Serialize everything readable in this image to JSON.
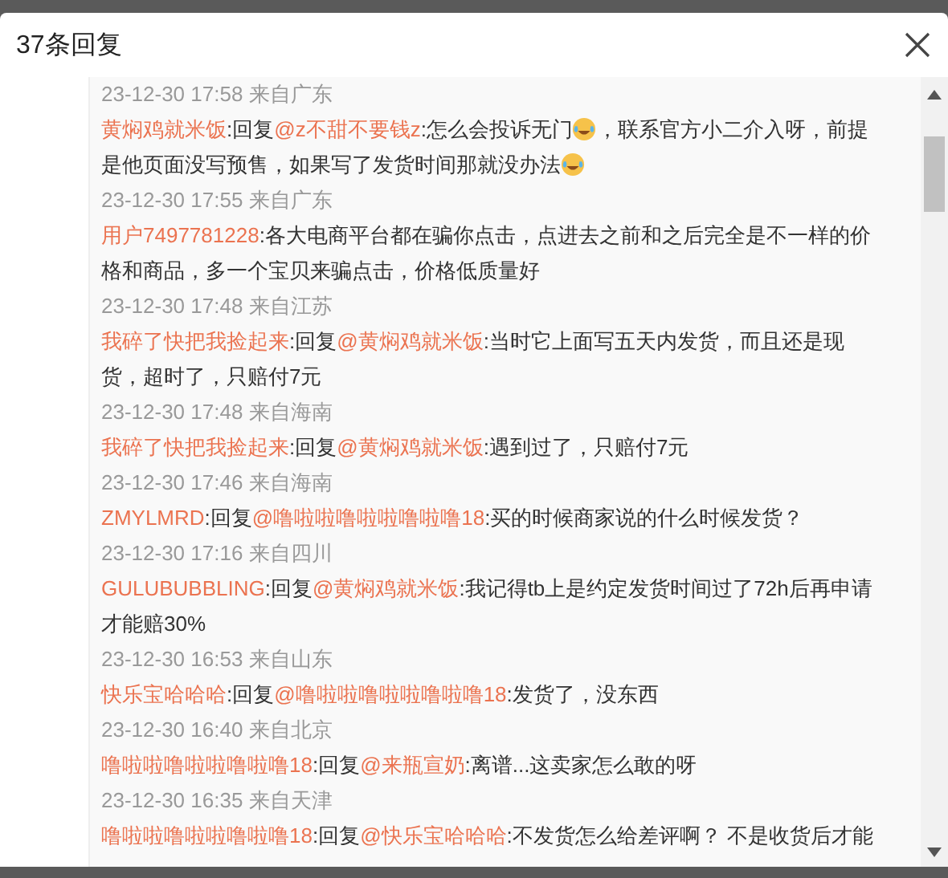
{
  "dialog": {
    "title": "37条回复"
  },
  "comments": [
    {
      "time": "23-12-30 17:58 来自广东",
      "body": [
        {
          "kind": "user",
          "text": "黄焖鸡就米饭"
        },
        {
          "kind": "text",
          "text": ":回复"
        },
        {
          "kind": "user",
          "text": "@z不甜不要钱z"
        },
        {
          "kind": "text",
          "text": ":怎么会投诉无门"
        },
        {
          "kind": "emoji"
        },
        {
          "kind": "text",
          "text": "，联系官方小二介入呀，前提是他页面没写预售，如果写了发货时间那就没办法"
        },
        {
          "kind": "emoji"
        }
      ]
    },
    {
      "time": "23-12-30 17:55 来自广东",
      "body": [
        {
          "kind": "user",
          "text": "用户7497781228"
        },
        {
          "kind": "text",
          "text": ":各大电商平台都在骗你点击，点进去之前和之后完全是不一样的价格和商品，多一个宝贝来骗点击，价格低质量好"
        }
      ]
    },
    {
      "time": "23-12-30 17:48 来自江苏",
      "body": [
        {
          "kind": "user",
          "text": "我碎了快把我捡起来"
        },
        {
          "kind": "text",
          "text": ":回复"
        },
        {
          "kind": "user",
          "text": "@黄焖鸡就米饭"
        },
        {
          "kind": "text",
          "text": ":当时它上面写五天内发货，而且还是现货，超时了，只赔付7元"
        }
      ]
    },
    {
      "time": "23-12-30 17:48 来自海南",
      "body": [
        {
          "kind": "user",
          "text": "我碎了快把我捡起来"
        },
        {
          "kind": "text",
          "text": ":回复"
        },
        {
          "kind": "user",
          "text": "@黄焖鸡就米饭"
        },
        {
          "kind": "text",
          "text": ":遇到过了，只赔付7元"
        }
      ]
    },
    {
      "time": "23-12-30 17:46 来自海南",
      "body": [
        {
          "kind": "user",
          "text": "ZMYLMRD"
        },
        {
          "kind": "text",
          "text": ":回复"
        },
        {
          "kind": "user",
          "text": "@噜啦啦噜啦啦噜啦噜18"
        },
        {
          "kind": "text",
          "text": ":买的时候商家说的什么时候发货？"
        }
      ]
    },
    {
      "time": "23-12-30 17:16 来自四川",
      "body": [
        {
          "kind": "user",
          "text": "GULUBUBBLING"
        },
        {
          "kind": "text",
          "text": ":回复"
        },
        {
          "kind": "user",
          "text": "@黄焖鸡就米饭"
        },
        {
          "kind": "text",
          "text": ":我记得tb上是约定发货时间过了72h后再申请才能赔30%"
        }
      ]
    },
    {
      "time": "23-12-30 16:53 来自山东",
      "body": [
        {
          "kind": "user",
          "text": "快乐宝哈哈哈"
        },
        {
          "kind": "text",
          "text": ":回复"
        },
        {
          "kind": "user",
          "text": "@噜啦啦噜啦啦噜啦噜18"
        },
        {
          "kind": "text",
          "text": ":发货了，没东西"
        }
      ]
    },
    {
      "time": "23-12-30 16:40 来自北京",
      "body": [
        {
          "kind": "user",
          "text": "噜啦啦噜啦啦噜啦噜18"
        },
        {
          "kind": "text",
          "text": ":回复"
        },
        {
          "kind": "user",
          "text": "@来瓶宣奶"
        },
        {
          "kind": "text",
          "text": ":离谱...这卖家怎么敢的呀"
        }
      ]
    },
    {
      "time": "23-12-30 16:35 来自天津",
      "body": [
        {
          "kind": "user",
          "text": "噜啦啦噜啦啦噜啦噜18"
        },
        {
          "kind": "text",
          "text": ":回复"
        },
        {
          "kind": "user",
          "text": "@快乐宝哈哈哈"
        },
        {
          "kind": "text",
          "text": ":不发货怎么给差评啊？ 不是收货后才能"
        }
      ]
    }
  ]
}
